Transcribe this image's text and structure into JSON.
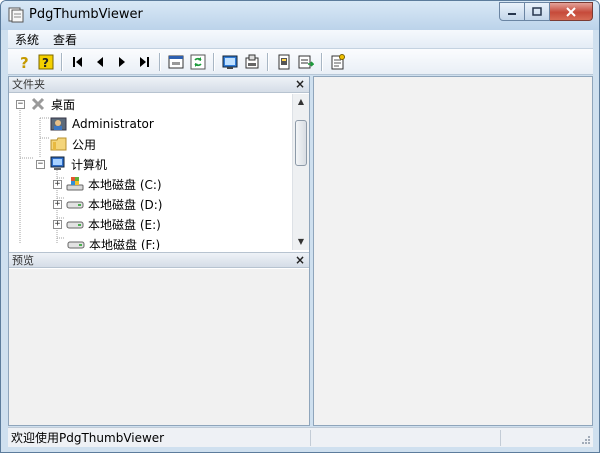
{
  "window": {
    "title": "PdgThumbViewer"
  },
  "menu": {
    "items": [
      "系统",
      "查看"
    ]
  },
  "toolbar": {
    "icons": [
      "help-icon",
      "help-topic-icon",
      "first-page-icon",
      "prev-page-icon",
      "next-page-icon",
      "last-page-icon",
      "window-icon",
      "refresh-icon",
      "view-icon",
      "export-icon",
      "print-icon",
      "save-icon",
      "properties-icon"
    ]
  },
  "folder_pane": {
    "title": "文件夹",
    "tree": [
      {
        "label": "桌面",
        "icon": "desktop-icon",
        "expander": "−"
      },
      {
        "label": "Administrator",
        "icon": "user-folder-icon"
      },
      {
        "label": "公用",
        "icon": "folder-icon"
      },
      {
        "label": "计算机",
        "icon": "computer-icon",
        "expander": "−"
      },
      {
        "label": "本地磁盘 (C:)",
        "icon": "system-drive-icon",
        "expander": "+"
      },
      {
        "label": "本地磁盘 (D:)",
        "icon": "drive-icon",
        "expander": "+"
      },
      {
        "label": "本地磁盘 (E:)",
        "icon": "drive-icon",
        "expander": "+"
      },
      {
        "label": "本地磁盘 (F:)",
        "icon": "drive-icon"
      }
    ]
  },
  "preview_pane": {
    "title": "预览"
  },
  "status": {
    "text": "欢迎使用PdgThumbViewer"
  },
  "colors": {
    "titlebar": "#c6d9ee",
    "close_button": "#c64a3a"
  }
}
